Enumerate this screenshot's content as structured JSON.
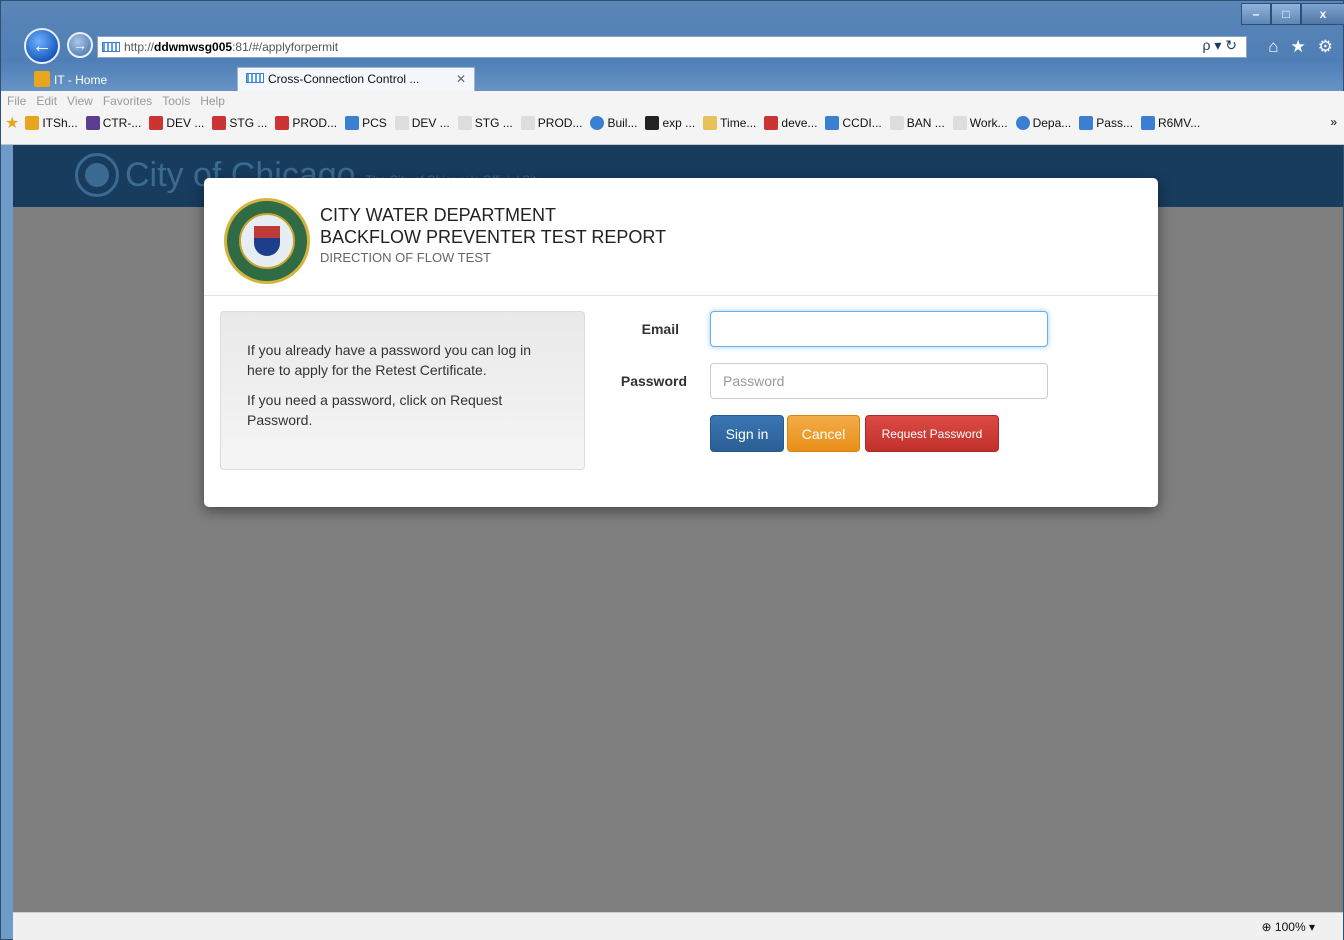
{
  "browser": {
    "url_prefix": "http://",
    "url_host": "ddwmwsg005",
    "url_rest": ":81/#/applyforpermit",
    "search_ctl": "ρ ▾ ↻",
    "tabs": [
      {
        "label": "IT - Home"
      },
      {
        "label": "Cross-Connection Control ...",
        "close": "✕"
      }
    ],
    "menu": [
      "File",
      "Edit",
      "View",
      "Favorites",
      "Tools",
      "Help"
    ],
    "favorites": [
      "ITSh...",
      "CTR-...",
      "DEV ...",
      "STG ...",
      "PROD...",
      "PCS",
      "DEV ...",
      "STG ...",
      "PROD...",
      "Buil...",
      "exp ...",
      "Time...",
      "deve...",
      "CCDI...",
      "BAN ...",
      "Work...",
      "Depa...",
      "Pass...",
      "R6MV..."
    ],
    "favorites_more": "»",
    "zoom": "100%",
    "window_controls": [
      "–",
      "□",
      "x"
    ]
  },
  "site": {
    "logo_text": "City of Chicago",
    "logo_sub": "The City of Chicago's Official Site"
  },
  "modal": {
    "title_line1": "CITY WATER DEPARTMENT",
    "title_line2": "BACKFLOW PREVENTER TEST REPORT",
    "subtitle": "DIRECTION OF FLOW TEST",
    "info_p1": "If you already have a password you can log in here to apply for the Retest Certificate.",
    "info_p2": "If you need a password, click on Request Password.",
    "email_label": "Email",
    "email_value": "",
    "password_label": "Password",
    "password_placeholder": "Password",
    "signin_label": "Sign in",
    "cancel_label": "Cancel",
    "request_label": "Request Password"
  }
}
